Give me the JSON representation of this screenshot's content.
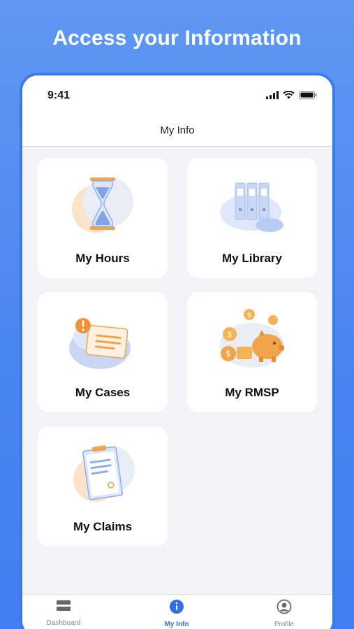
{
  "headline": "Access your Information",
  "status_bar": {
    "time": "9:41"
  },
  "header": {
    "title": "My Info"
  },
  "cards": [
    {
      "label": "My Hours",
      "icon": "hourglass-icon"
    },
    {
      "label": "My Library",
      "icon": "binders-icon"
    },
    {
      "label": "My Cases",
      "icon": "case-alert-icon"
    },
    {
      "label": "My RMSP",
      "icon": "piggy-bank-icon"
    },
    {
      "label": "My Claims",
      "icon": "clipboard-icon"
    }
  ],
  "tabbar": {
    "items": [
      {
        "label": "Dashboard",
        "icon": "dashboard-icon",
        "active": false
      },
      {
        "label": "My Info",
        "icon": "info-icon",
        "active": true
      },
      {
        "label": "Profile",
        "icon": "profile-icon",
        "active": false
      }
    ]
  },
  "colors": {
    "accent": "#3b7ae8",
    "orange": "#f0a44b",
    "blue_soft": "#dfe7fb"
  }
}
